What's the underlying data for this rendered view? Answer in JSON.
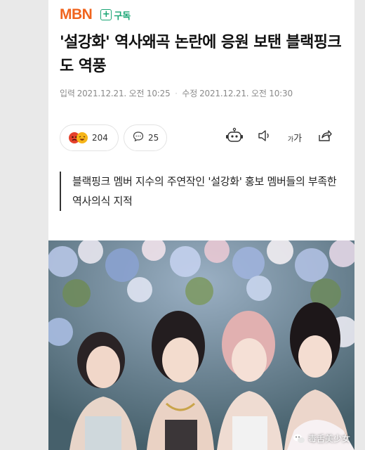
{
  "header": {
    "logo_text": "MBN",
    "subscribe_label": "구독",
    "brand_color": "#f0641e",
    "accent_color": "#19a574"
  },
  "article": {
    "title": "'설강화' 역사왜곡 논란에 응원 보탠 블랙핑크도 역풍",
    "input_date_label": "입력",
    "input_date": "2021.12.21. 오전 10:25",
    "modified_date_label": "수정",
    "modified_date": "2021.12.21. 오전 10:30",
    "summary": "블랙핑크 멤버 지수의 주연작인 '설강화' 홍보 멤버들의 부족한 역사의식 지적"
  },
  "actions": {
    "reaction_count": "204",
    "comment_count": "25",
    "font_size_label": "가",
    "icons": [
      "reaction-emoji-icon",
      "comment-icon",
      "robot-summary-icon",
      "speaker-icon",
      "font-size-icon",
      "share-icon"
    ]
  },
  "photo": {
    "watermark_text": "毒舌美少女",
    "watermark_icon": "wechat-icon"
  }
}
